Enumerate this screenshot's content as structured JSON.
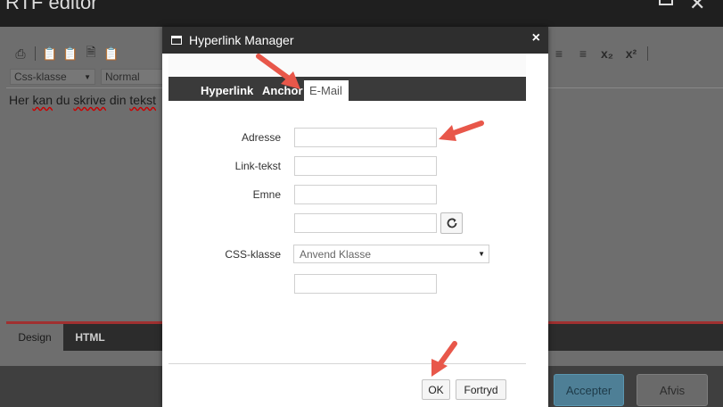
{
  "background_window": {
    "title": "RTF editor",
    "toolbar": {
      "css_class_select": "Css-klasse",
      "format_select": "Normal"
    },
    "content_text_parts": [
      "Her ",
      "kan",
      " du ",
      "skrive",
      " din ",
      "tekst"
    ],
    "tabs": [
      "Design",
      "HTML"
    ],
    "buttons": {
      "accept": "Accepter",
      "reject": "Afvis"
    }
  },
  "dialog": {
    "title": "Hyperlink Manager",
    "close_symbol": "×",
    "tabs": {
      "hyperlink": "Hyperlink",
      "anchor": "Anchor",
      "email": "E-Mail"
    },
    "active_tab": "E-Mail",
    "fields": {
      "address_label": "Adresse",
      "link_text_label": "Link-tekst",
      "subject_label": "Emne",
      "css_class_label": "CSS-klasse",
      "css_class_value": "Anvend Klasse"
    },
    "buttons": {
      "ok": "OK",
      "cancel": "Fortryd"
    }
  },
  "colors": {
    "annotation_arrow": "#e8574a",
    "dialog_header": "#2e2e2e",
    "accept_button": "#4e7f96"
  }
}
